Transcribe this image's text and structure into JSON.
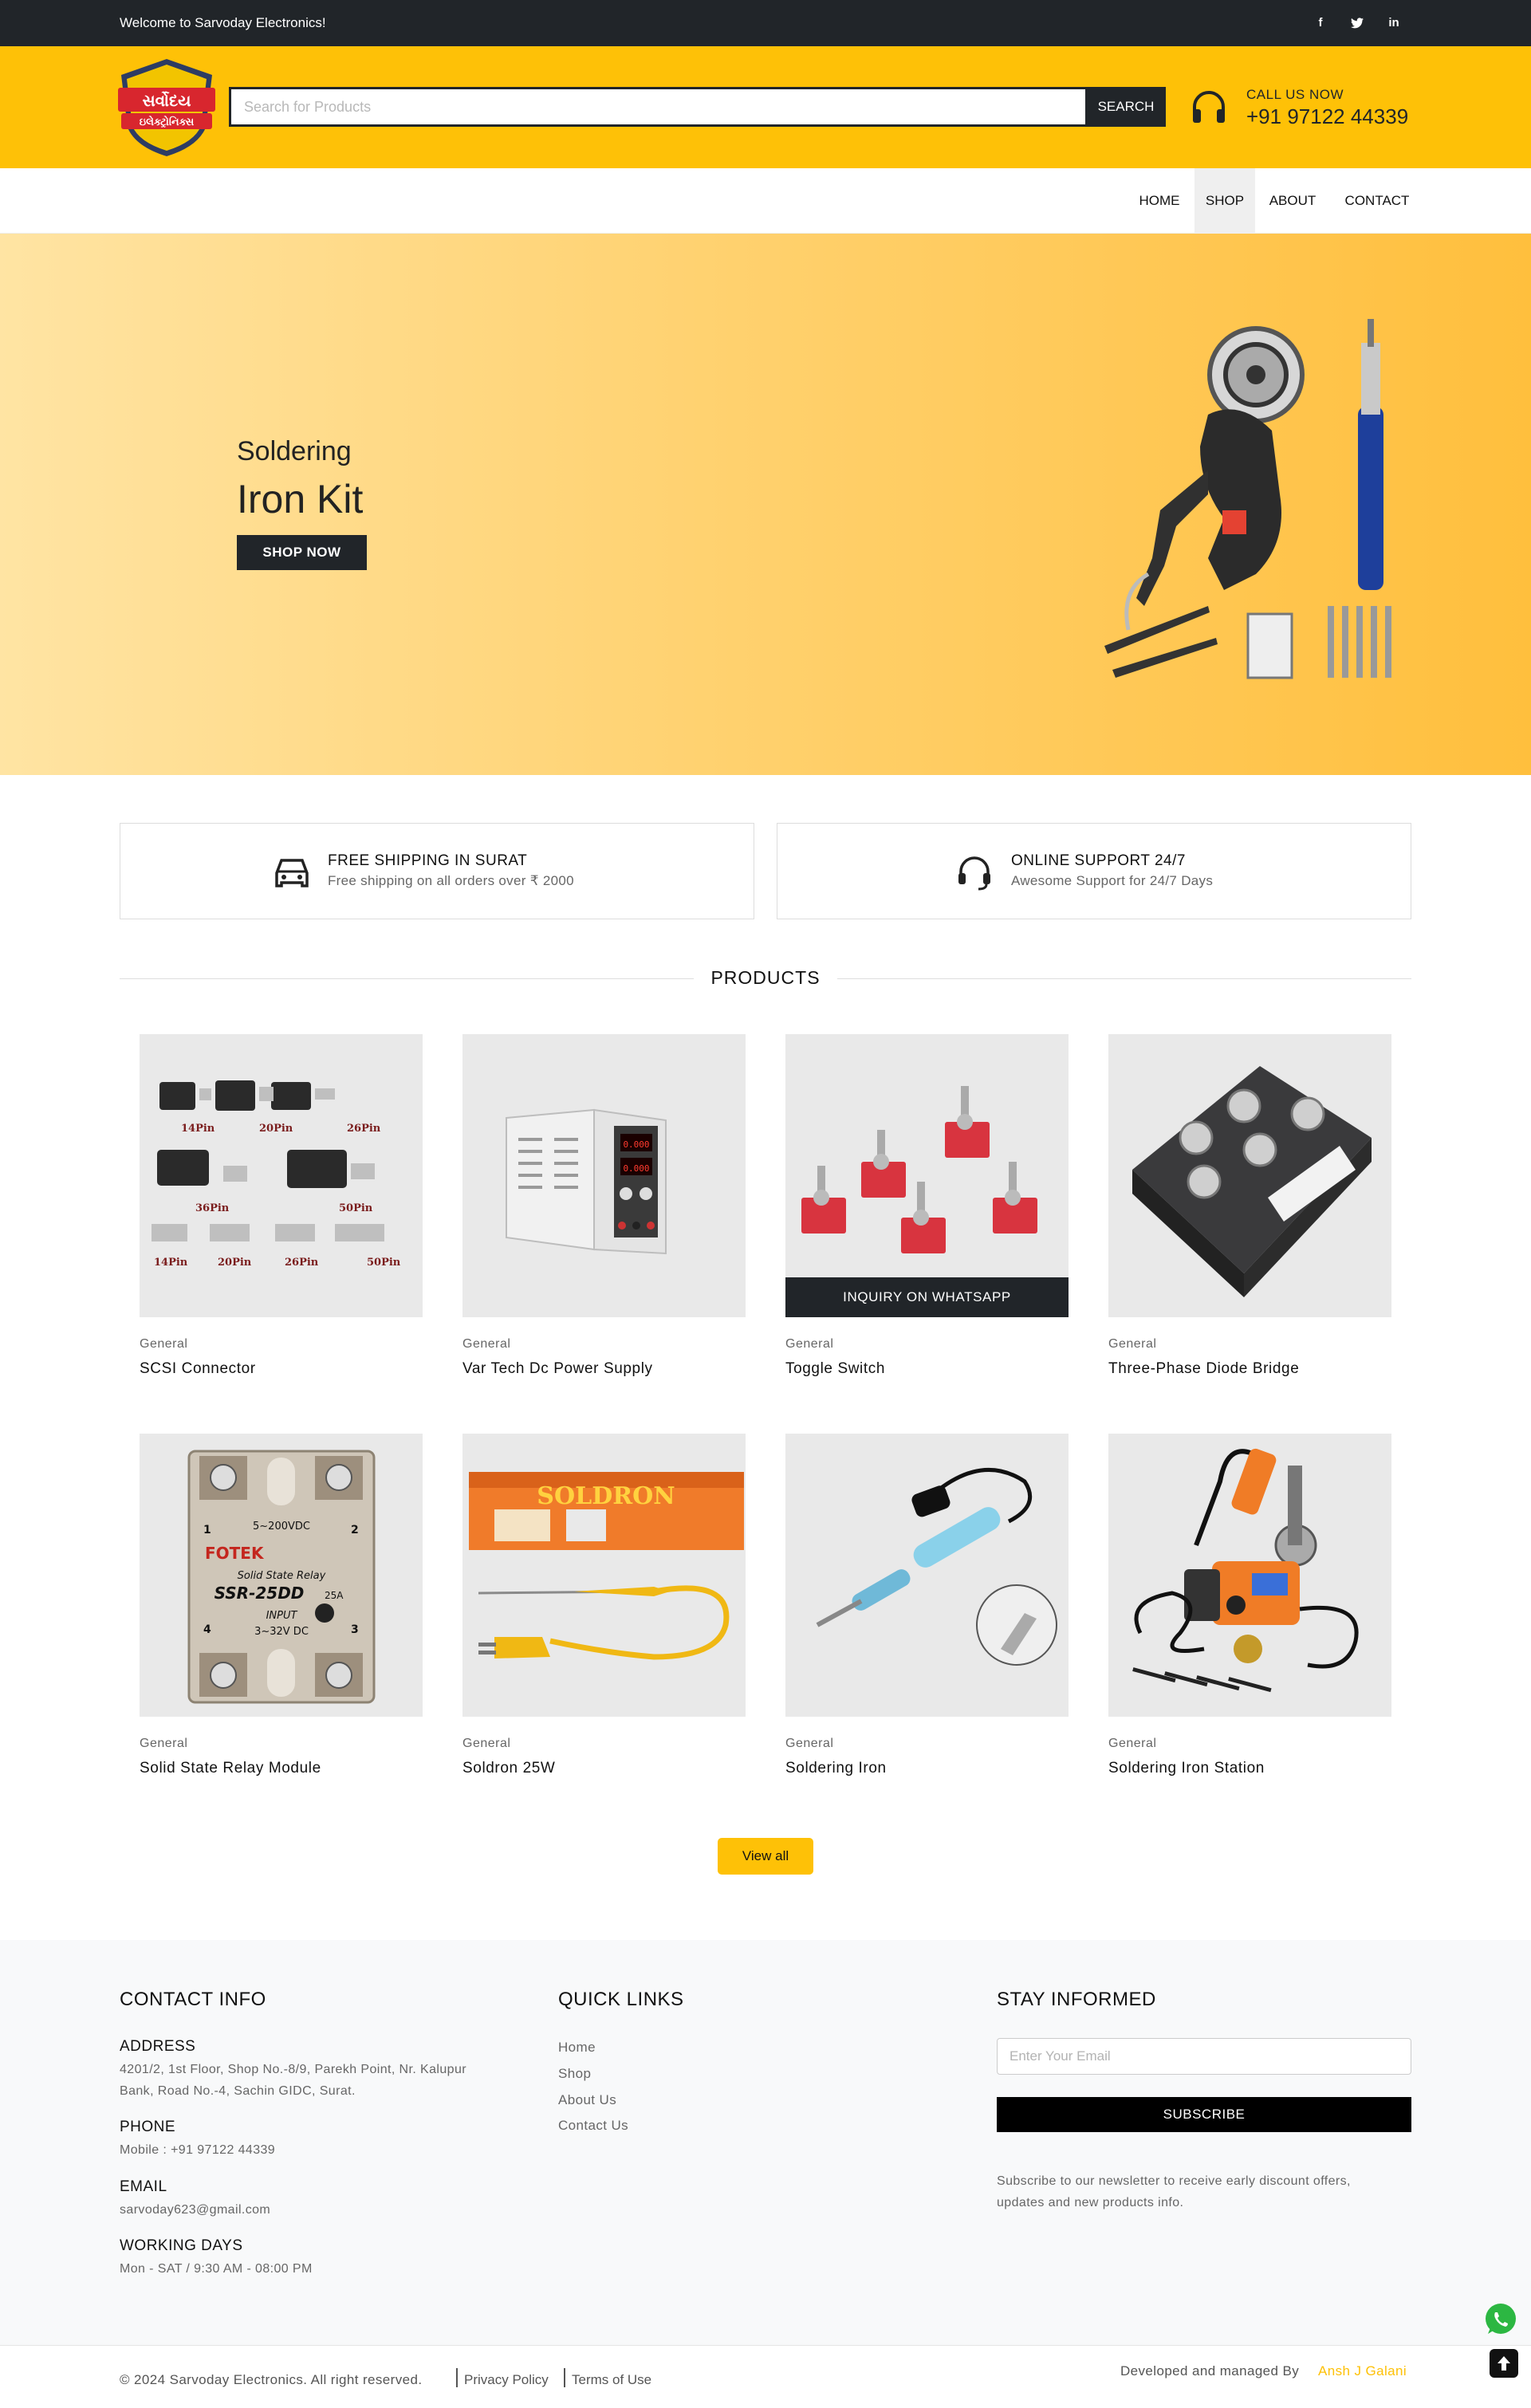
{
  "topbar": {
    "welcome": "Welcome to Sarvoday Electronics!",
    "social": [
      {
        "icon": "facebook-icon",
        "glyph": "f"
      },
      {
        "icon": "twitter-icon",
        "glyph": "🐦"
      },
      {
        "icon": "linkedin-icon",
        "glyph": "in"
      }
    ]
  },
  "brand": {
    "logo_text_top": "સર્વોદય",
    "logo_text_bottom": "ઇલેક્ટ્રોનિક્સ",
    "accent": "#fec107",
    "dark": "#212529"
  },
  "search": {
    "placeholder": "Search for Products",
    "button": "SEARCH"
  },
  "call": {
    "label": "CALL US NOW",
    "number": "+91 97122 44339"
  },
  "nav": {
    "items": [
      "HOME",
      "SHOP",
      "ABOUT",
      "CONTACT"
    ],
    "active": "SHOP"
  },
  "hero": {
    "subtitle": "Soldering",
    "title": "Iron Kit",
    "button": "SHOP NOW"
  },
  "features": [
    {
      "title": "FREE SHIPPING IN SURAT",
      "desc": "Free shipping on all orders over ₹ 2000",
      "icon": "car-icon"
    },
    {
      "title": "ONLINE SUPPORT 24/7",
      "desc": "Awesome Support for 24/7 Days",
      "icon": "headset-icon"
    }
  ],
  "products": {
    "heading": "PRODUCTS",
    "inquiry_label": "INQUIRY ON WHATSAPP",
    "items": [
      {
        "category": "General",
        "name": "SCSI Connector",
        "labels": [
          "14Pin",
          "20Pin",
          "26Pin",
          "36Pin",
          "50Pin",
          "14Pin",
          "20Pin",
          "26Pin",
          "50Pin"
        ]
      },
      {
        "category": "General",
        "name": "Var Tech Dc Power Supply",
        "display": [
          "0.000",
          "0.000"
        ]
      },
      {
        "category": "General",
        "name": "Toggle Switch"
      },
      {
        "category": "General",
        "name": "Three-Phase Diode Bridge"
      },
      {
        "category": "General",
        "name": "Solid State Relay Module",
        "labels": [
          "5~200VDC",
          "FOTEK",
          "Solid State Relay",
          "SSR-25DD",
          "25A",
          "INPUT",
          "3~32V DC",
          "1",
          "2",
          "3",
          "4"
        ]
      },
      {
        "category": "General",
        "name": "Soldron 25W",
        "labels": [
          "SOLDRON"
        ]
      },
      {
        "category": "General",
        "name": "Soldering Iron"
      },
      {
        "category": "General",
        "name": "Soldering Iron Station"
      }
    ],
    "view_all": "View all"
  },
  "footer": {
    "contact": {
      "heading": "CONTACT INFO",
      "address_label": "ADDRESS",
      "address_line1": "4201/2, 1st Floor, Shop No.-8/9, Parekh Point, Nr. Kalupur",
      "address_line2": "Bank, Road No.-4, Sachin GIDC, Surat.",
      "phone_label": "PHONE",
      "phone": "Mobile : +91 97122 44339",
      "email_label": "EMAIL",
      "email": "sarvoday623@gmail.com",
      "days_label": "WORKING DAYS",
      "days": "Mon - SAT / 9:30 AM - 08:00 PM"
    },
    "links": {
      "heading": "QUICK LINKS",
      "items": [
        "Home",
        "Shop",
        "About Us",
        "Contact Us"
      ]
    },
    "newsletter": {
      "heading": "STAY INFORMED",
      "placeholder": "Enter Your Email",
      "button": "SUBSCRIBE",
      "text_line1": "Subscribe to our newsletter to receive early discount offers,",
      "text_line2": "updates and new products info."
    }
  },
  "bottom": {
    "copyright": "© 2024 Sarvoday Electronics. All right reserved.",
    "privacy": "Privacy Policy",
    "terms": "Terms of Use",
    "developed": "Developed and managed By",
    "developer": "Ansh J Galani"
  }
}
